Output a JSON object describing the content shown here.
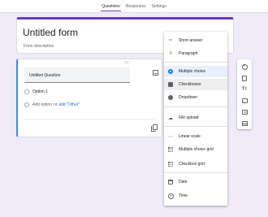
{
  "tabs": [
    {
      "label": "Questions",
      "active": true
    },
    {
      "label": "Responses",
      "active": false
    },
    {
      "label": "Settings",
      "active": false
    }
  ],
  "form": {
    "title": "Untitled form",
    "description_placeholder": "Form description"
  },
  "question": {
    "title": "Untitled Question",
    "drag_handle": "⠿⠿",
    "option1": "Option 1",
    "add_option": "Add option",
    "or_text": "or",
    "add_other": "add \"Other\""
  },
  "menu": {
    "items": [
      {
        "label": "Short answer",
        "icon": "short-answer-icon"
      },
      {
        "label": "Paragraph",
        "icon": "paragraph-icon"
      },
      {
        "label": "Multiple choice",
        "icon": "radio-button-icon",
        "selected": true
      },
      {
        "label": "Checkboxes",
        "icon": "checkbox-icon",
        "highlighted": true
      },
      {
        "label": "Dropdown",
        "icon": "dropdown-icon"
      },
      {
        "label": "File upload",
        "icon": "cloud-upload-icon"
      },
      {
        "label": "Linear scale",
        "icon": "linear-scale-icon"
      },
      {
        "label": "Multiple choice grid",
        "icon": "grid-icon"
      },
      {
        "label": "Checkbox grid",
        "icon": "checkbox-grid-icon"
      },
      {
        "label": "Date",
        "icon": "calendar-icon"
      },
      {
        "label": "Time",
        "icon": "clock-icon"
      }
    ]
  },
  "sidebar": {
    "items": [
      "add-question-icon",
      "import-questions-icon",
      "add-title-icon",
      "add-image-icon",
      "add-video-icon",
      "add-section-icon"
    ],
    "title_glyph": "Tт"
  },
  "colors": {
    "accent": "#673ab7",
    "active_question": "#4285f4",
    "background": "#f0ebf8",
    "link": "#1a73e8"
  }
}
